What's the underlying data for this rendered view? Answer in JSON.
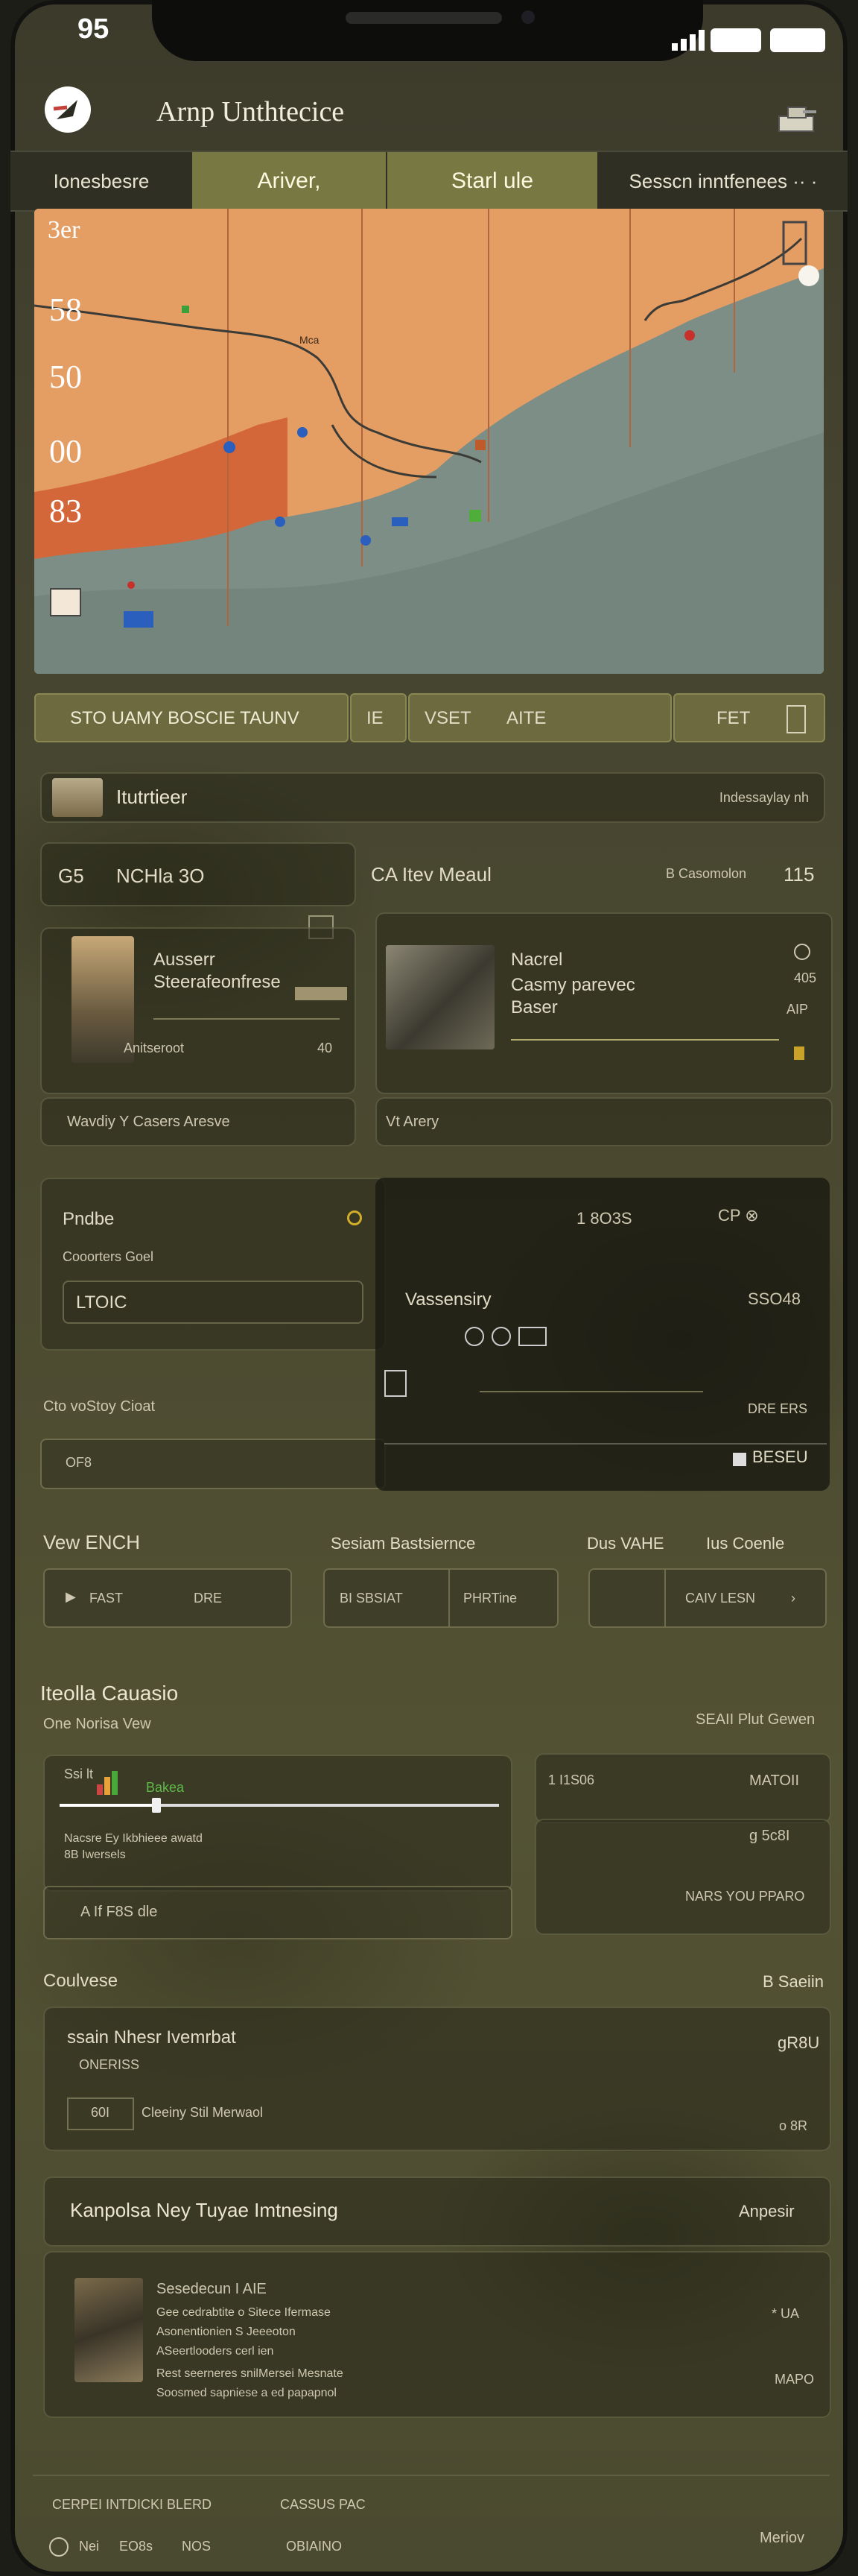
{
  "status": {
    "time": "95"
  },
  "header": {
    "title": "Arnp Unthtecice"
  },
  "tabs": [
    {
      "label": "Ionesbesre",
      "active": false
    },
    {
      "label": "Ariver,",
      "active": true
    },
    {
      "label": "Starl ule",
      "active": true
    },
    {
      "label": "Sesscn inntfenees ·· ·",
      "active": false
    }
  ],
  "map": {
    "labels": [
      "3er",
      "58",
      "50",
      "00",
      "83"
    ],
    "small_label": "Mca"
  },
  "action_bar": {
    "left": "STO UAMY BOSCIE TAUNV",
    "mid_icon": "IE",
    "mid": "VSET",
    "mid2": "AITE",
    "right": "FET"
  },
  "search_row": {
    "label": "Itutrtieer",
    "right": "Indessaylay nh"
  },
  "cards_header": {
    "left_id": "G5",
    "left_title": "NCHla 3O",
    "right_title": "CA Itev Meaul",
    "right_meta": "B Casomolon",
    "right_num": "115"
  },
  "card_left": {
    "title": "Ausserr",
    "subtitle": "Steerafeonfrese",
    "footer": "Anitseroot",
    "footer_num": "40"
  },
  "card_right": {
    "title": "Nacrel",
    "line2": "Casmy parevec",
    "line3": "Baser",
    "side1": "405",
    "side2": "AIP"
  },
  "card_footers": {
    "left": "Wavdiy Y Casers Aresve",
    "right": "Vt Arery"
  },
  "profile_panel": {
    "title": "Pndbe",
    "sub": "Cooorters Goel",
    "field": "LTOIC",
    "below": "Cto voStoy Cioat",
    "field2": "OF8"
  },
  "dark_panel": {
    "top": "1 8O3S",
    "top_right": "CP ⊗",
    "title": "Vassensiry",
    "right": "SSO48",
    "row_right": "DRE ERS",
    "button": "BESEU"
  },
  "filters": {
    "col1_title": "Vew ENCH",
    "col2_title": "Sesiam Bastsiernce",
    "col3_title": "Dus VAHE",
    "col3_right": "Ius Coenle",
    "btn1": "FAST",
    "btn1b": "DRE",
    "btn2": "BI SBSIAT",
    "btn2b": "PHRTine",
    "btn3": "CAIV LESN"
  },
  "media": {
    "title": "Iteolla Cauasio",
    "sub": "One Norisa Vew",
    "right": "SEAII Plut Gewen",
    "slider_label": "Ssi lt",
    "slider_tag": "Bakea",
    "slider_value": 0.22,
    "note1": "Nacsre Ey Ikbhieee awatd",
    "note2": "8B Iwersels",
    "bottom": "A If F8S dle",
    "r1_left": "1 I1S06",
    "r1_right": "MATOII",
    "r2_right": "g 5c8I",
    "r3": "NARS YOU PPARO"
  },
  "course": {
    "title": "Coulvese",
    "right": "B Saeiin",
    "panel_title": "ssain Nhesr Ivemrbat",
    "panel_sub": "ONERISS",
    "panel_right": "gR8U",
    "row_num": "60I",
    "row_text": "Cleeiny Stil Merwaol",
    "row_right": "o 8R"
  },
  "knowledge": {
    "title": "Kanpolsa Ney Tuyae Imtnesing",
    "right": "Anpesir",
    "item_title": "Sesedecun I AIE",
    "item_l1": "Gee cedrabtite o Sitece Ifermase",
    "item_l2": "Asonentionien S Jeeeoton",
    "item_l3": "ASeertlooders cerl ien",
    "item_l4": "Rest seerneres snilMersei Mesnate",
    "item_l5": "Soosmed sapniese a ed papapnol",
    "side1": "* UA",
    "side2": "MAPO"
  },
  "footer": {
    "left": "CERPEI INTDICKI BLERD",
    "mid": "CASSUS PAC",
    "n1": "Nei",
    "n2": "EO8s",
    "n3": "NOS",
    "n4": "OBIAINO",
    "right": "Meriov"
  }
}
